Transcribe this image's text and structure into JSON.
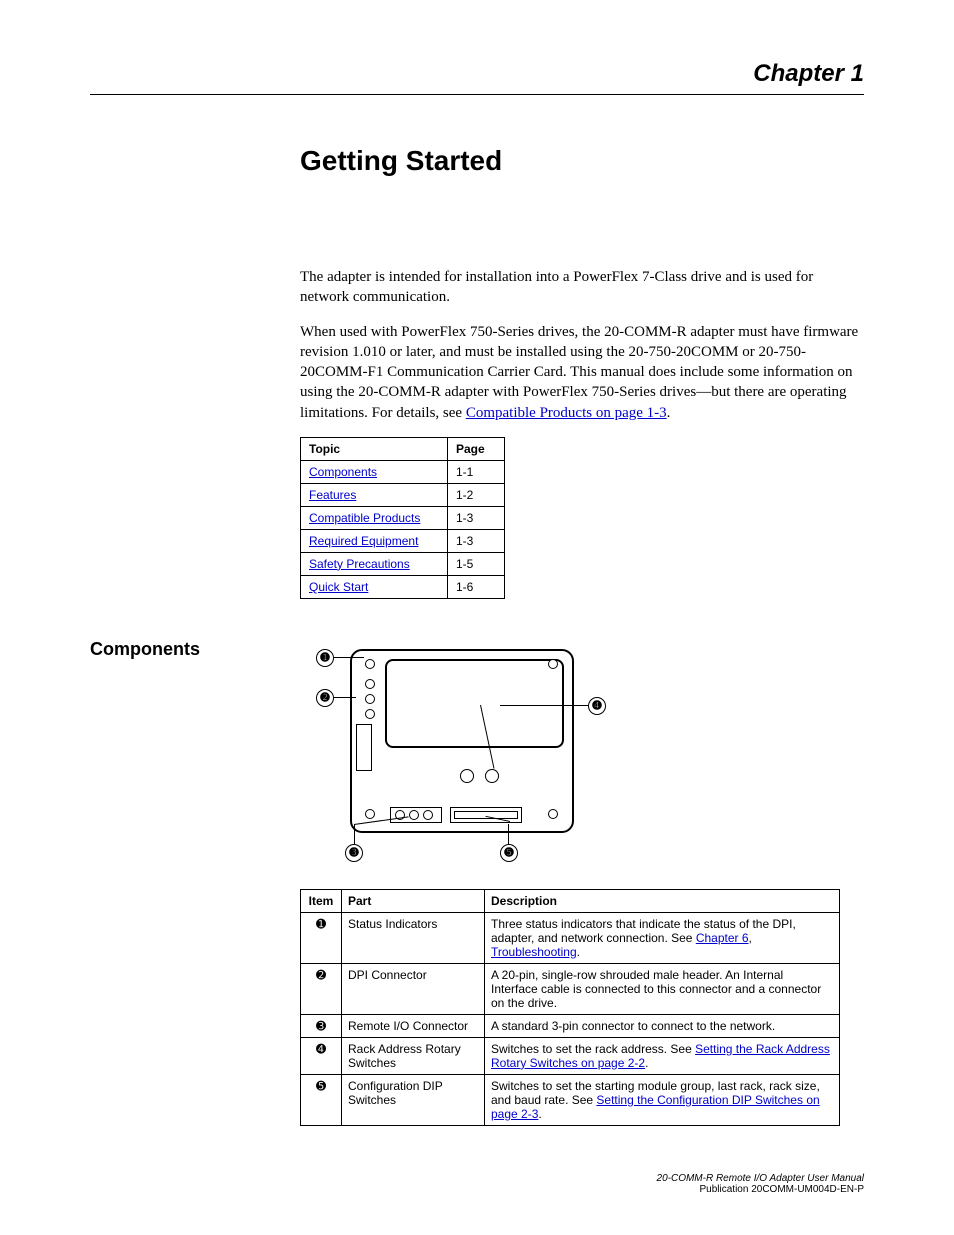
{
  "header": {
    "chapter": "Chapter 1"
  },
  "title": "Getting Started",
  "para1": "The adapter is intended for installation into a PowerFlex 7-Class drive and is used for network communication.",
  "para2_a": "When used with PowerFlex 750-Series drives, the 20-COMM-R adapter must have firmware revision 1.010 or later, and must be installed using the 20-750-20COMM or 20-750-20COMM-F1 Communication Carrier Card. This manual does include some information on using the 20-COMM-R adapter with PowerFlex 750-Series drives—but there are operating limitations. For details, see ",
  "para2_link": "Compatible Products on page 1-3",
  "para2_b": ".",
  "topic_table": {
    "head_topic": "Topic",
    "head_page": "Page",
    "rows": [
      {
        "topic": "Components",
        "page": "1-1"
      },
      {
        "topic": "Features",
        "page": "1-2"
      },
      {
        "topic": "Compatible Products",
        "page": "1-3"
      },
      {
        "topic": "Required Equipment",
        "page": "1-3"
      },
      {
        "topic": "Safety Precautions",
        "page": "1-5"
      },
      {
        "topic": "Quick Start",
        "page": "1-6"
      }
    ]
  },
  "section_heading": "Components",
  "callouts": {
    "c1": "➊",
    "c2": "➋",
    "c3": "➌",
    "c4": "➍",
    "c5": "➎"
  },
  "comp_table": {
    "head_item": "Item",
    "head_part": "Part",
    "head_desc": "Description",
    "rows": [
      {
        "item": "➊",
        "part": "Status Indicators",
        "desc_a": "Three status indicators that indicate the status of the DPI, adapter, and network connection. See ",
        "link1": "Chapter 6",
        "mid": ", ",
        "link2": "Troubleshooting",
        "desc_b": "."
      },
      {
        "item": "➋",
        "part": "DPI Connector",
        "desc_a": "A 20-pin, single-row shrouded male header. An Internal Interface cable is connected to this connector and a connector on the drive.",
        "link1": "",
        "mid": "",
        "link2": "",
        "desc_b": ""
      },
      {
        "item": "➌",
        "part": "Remote I/O Connector",
        "desc_a": "A standard 3-pin connector to connect to the network.",
        "link1": "",
        "mid": "",
        "link2": "",
        "desc_b": ""
      },
      {
        "item": "➍",
        "part": "Rack Address Rotary Switches",
        "desc_a": "Switches to set the rack address. See ",
        "link1": "Setting the Rack Address Rotary Switches on page 2-2",
        "mid": "",
        "link2": "",
        "desc_b": "."
      },
      {
        "item": "➎",
        "part": "Configuration DIP Switches",
        "desc_a": "Switches to set the starting module group, last rack, rack size, and baud rate. See ",
        "link1": "Setting the Configuration DIP Switches on page 2-3",
        "mid": "",
        "link2": "",
        "desc_b": "."
      }
    ]
  },
  "footer": {
    "line1": "20-COMM-R Remote I/O Adapter User Manual",
    "line2": "Publication 20COMM-UM004D-EN-P"
  }
}
